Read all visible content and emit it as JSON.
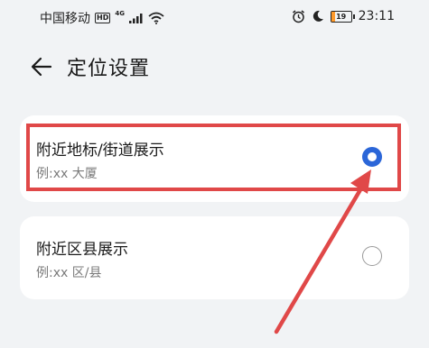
{
  "status_bar": {
    "carrier": "中国移动",
    "hd_badge": "HD",
    "network": "4G",
    "battery_level": "19",
    "time": "23:11",
    "icons": [
      "signal-icon",
      "wifi-icon",
      "alarm-icon",
      "moon-icon",
      "battery-icon"
    ]
  },
  "header": {
    "title": "定位设置",
    "back_icon": "back-arrow-icon"
  },
  "options": [
    {
      "title": "附近地标/街道展示",
      "example": "例:xx 大厦",
      "selected": true
    },
    {
      "title": "附近区县展示",
      "example": "例:xx 区/县",
      "selected": false
    }
  ],
  "colors": {
    "accent": "#2b66d8",
    "annotation": "#e04848",
    "background": "#f1f3f5",
    "card": "#ffffff"
  }
}
